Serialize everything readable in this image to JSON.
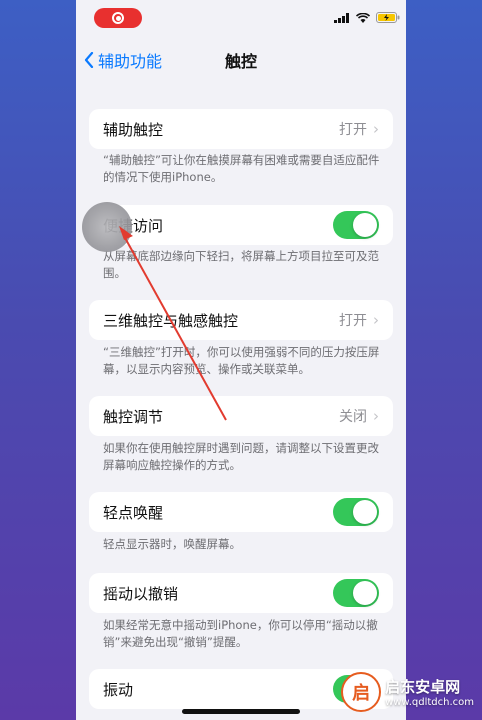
{
  "nav": {
    "back_label": "辅助功能",
    "title": "触控"
  },
  "rows": [
    {
      "label": "辅助触控",
      "value": "打开",
      "note": "“辅助触控”可让你在触摸屏幕有困难或需要自适应配件的情况下使用iPhone。"
    },
    {
      "label": "便捷访问",
      "toggle": true,
      "note": "从屏幕底部边缘向下轻扫，将屏幕上方项目拉至可及范围。"
    },
    {
      "label": "三维触控与触感触控",
      "value": "打开",
      "note": "“三维触控”打开时，你可以使用强弱不同的压力按压屏幕，以显示内容预览、操作或关联菜单。"
    },
    {
      "label": "触控调节",
      "value": "关闭",
      "note": "如果你在使用触控屏时遇到问题，请调整以下设置更改屏幕响应触控操作的方式。"
    },
    {
      "label": "轻点唤醒",
      "toggle": true,
      "note": "轻点显示器时，唤醒屏幕。"
    },
    {
      "label": "摇动以撤销",
      "toggle": true,
      "note": "如果经常无意中摇动到iPhone，你可以停用“摇动以撤销”来避免出现“撤销”提醒。"
    },
    {
      "label": "振动",
      "toggle": true,
      "note": ""
    }
  ],
  "colors": {
    "accent": "#0a7aff",
    "toggle_on": "#34c759",
    "recording": "#e8302f",
    "arrow": "#e23b2f"
  },
  "watermark": {
    "name": "启东安卓网",
    "url": "www.qdltdch.com"
  }
}
